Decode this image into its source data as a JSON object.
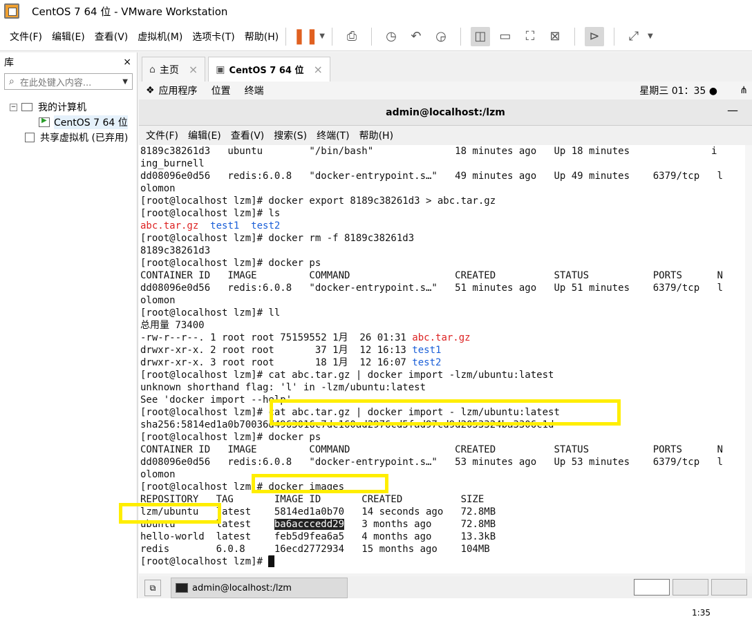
{
  "window": {
    "title": "CentOS 7 64 位 - VMware Workstation"
  },
  "menu": {
    "file": "文件(F)",
    "edit": "编辑(E)",
    "view": "查看(V)",
    "vm": "虚拟机(M)",
    "tabs": "选项卡(T)",
    "help": "帮助(H)"
  },
  "library": {
    "title": "库",
    "close": "×",
    "search_placeholder": "在此处键入内容...",
    "items": [
      {
        "label": "我的计算机"
      },
      {
        "label": "CentOS 7 64 位"
      },
      {
        "label": "共享虚拟机 (已弃用)"
      }
    ]
  },
  "tabs": [
    {
      "label": "主页",
      "close": "×"
    },
    {
      "label": "CentOS 7 64 位",
      "close": "×"
    }
  ],
  "gnome": {
    "apps": "应用程序",
    "places": "位置",
    "terminal": "终端",
    "clock": "星期三 01：35 ●"
  },
  "terminal": {
    "title": "admin@localhost:/lzm",
    "menu": [
      "文件(F)",
      "编辑(E)",
      "查看(V)",
      "搜索(S)",
      "终端(T)",
      "帮助(H)"
    ],
    "lines": [
      "8189c38261d3   ubuntu        \"/bin/bash\"              18 minutes ago   Up 18 minutes              i",
      "ing_burnell",
      "dd08096e0d56   redis:6.0.8   \"docker-entrypoint.s…\"   49 minutes ago   Up 49 minutes    6379/tcp   l",
      "olomon",
      "[root@localhost lzm]# docker export 8189c38261d3 > abc.tar.gz",
      "[root@localhost lzm]# ls",
      "",
      "[root@localhost lzm]# docker rm -f 8189c38261d3",
      "8189c38261d3",
      "[root@localhost lzm]# docker ps",
      "CONTAINER ID   IMAGE         COMMAND                  CREATED          STATUS           PORTS      N",
      "dd08096e0d56   redis:6.0.8   \"docker-entrypoint.s…\"   51 minutes ago   Up 51 minutes    6379/tcp   l",
      "olomon",
      "[root@localhost lzm]# ll",
      "总用量 73400",
      "",
      "",
      "",
      "[root@localhost lzm]# cat abc.tar.gz | docker import -lzm/ubuntu:latest",
      "unknown shorthand flag: 'l' in -lzm/ubuntu:latest",
      "See 'docker import --help'.",
      "[root@localhost lzm]# cat abc.tar.gz | docker import - lzm/ubuntu:latest",
      "sha256:5814ed1a0b70036d4963016c7dc160ad2976cd5fad97cd9d2053324ba3306c1d",
      "[root@localhost lzm]# docker ps",
      "CONTAINER ID   IMAGE         COMMAND                  CREATED          STATUS           PORTS      N",
      "dd08096e0d56   redis:6.0.8   \"docker-entrypoint.s…\"   53 minutes ago   Up 53 minutes    6379/tcp   l",
      "olomon",
      "[root@localhost lzm]# docker images",
      "REPOSITORY   TAG       IMAGE ID       CREATED          SIZE",
      "lzm/ubuntu   latest    5814ed1a0b70   14 seconds ago   72.8MB",
      "",
      "hello-world  latest    feb5d9fea6a5   4 months ago     13.3kB",
      "redis        6.0.8     16ecd2772934   15 months ago    104MB",
      "[root@localhost lzm]# "
    ],
    "ls_files": [
      "abc.tar.gz",
      "test1",
      "test2"
    ],
    "ll_rows": [
      {
        "prefix": "-rw-r--r--. 1 root root 75159552 1月  26 01:31 ",
        "name": "abc.tar.gz"
      },
      {
        "prefix": "drwxr-xr-x. 2 root root       37 1月  12 16:13 ",
        "name": "test1"
      },
      {
        "prefix": "drwxr-xr-x. 3 root root       18 1月  12 16:07 ",
        "name": "test2"
      }
    ],
    "ubuntu_row": {
      "prefix": "ubuntu       latest    ",
      "id": "ba6acccedd29",
      "suffix": "   3 months ago     72.8MB"
    }
  },
  "vmstatus": {
    "task": "admin@localhost:/lzm"
  },
  "taskbar": {
    "time": "1:35"
  }
}
